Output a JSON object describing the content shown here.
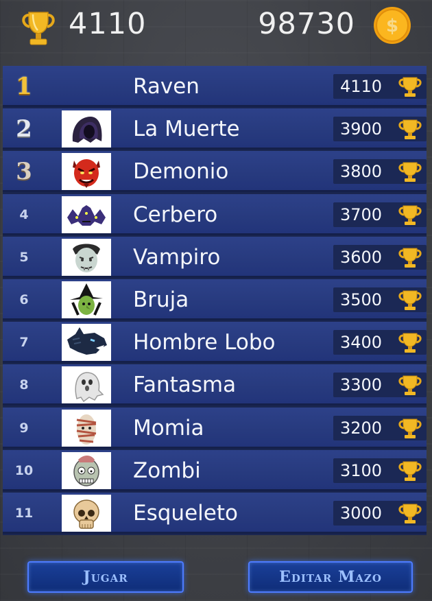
{
  "header": {
    "trophies": "4110",
    "coins": "98730"
  },
  "leaderboard": [
    {
      "rank": "1",
      "name": "Raven",
      "score": "4110",
      "avatar": "none"
    },
    {
      "rank": "2",
      "name": "La Muerte",
      "score": "3900",
      "avatar": "hooded-reaper-icon"
    },
    {
      "rank": "3",
      "name": "Demonio",
      "score": "3800",
      "avatar": "red-demon-icon"
    },
    {
      "rank": "4",
      "name": "Cerbero",
      "score": "3700",
      "avatar": "three-headed-dog-icon"
    },
    {
      "rank": "5",
      "name": "Vampiro",
      "score": "3600",
      "avatar": "vampire-icon"
    },
    {
      "rank": "6",
      "name": "Bruja",
      "score": "3500",
      "avatar": "witch-icon"
    },
    {
      "rank": "7",
      "name": "Hombre Lobo",
      "score": "3400",
      "avatar": "werewolf-icon"
    },
    {
      "rank": "8",
      "name": "Fantasma",
      "score": "3300",
      "avatar": "ghost-icon"
    },
    {
      "rank": "9",
      "name": "Momia",
      "score": "3200",
      "avatar": "mummy-icon"
    },
    {
      "rank": "10",
      "name": "Zombi",
      "score": "3100",
      "avatar": "zombie-icon"
    },
    {
      "rank": "11",
      "name": "Esqueleto",
      "score": "3000",
      "avatar": "skull-icon"
    }
  ],
  "buttons": {
    "play": "Jugar",
    "edit_deck": "Editar Mazo"
  },
  "colors": {
    "row_blue": "#2d4189",
    "score_box": "#1b2855",
    "gold": "#f2c23a",
    "button_glow": "#4d7bff"
  }
}
